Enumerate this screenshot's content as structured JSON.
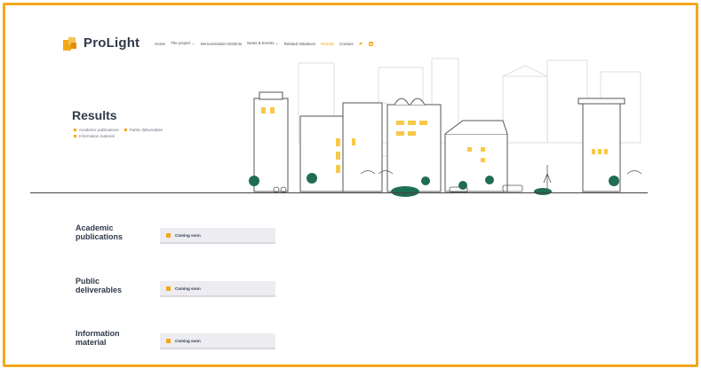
{
  "brand": {
    "name": "ProLight",
    "accent": "#f3a81b"
  },
  "nav": {
    "items": [
      "Home",
      "The project ⌄",
      "Demonstration Districts",
      "News & Events ⌄",
      "Related Initiatives",
      "Results",
      "Contact"
    ],
    "active_index": 5
  },
  "hero": {
    "title": "Results",
    "links": [
      "Academic publications",
      "Public deliverables",
      "Information material"
    ]
  },
  "sections": [
    {
      "title": "Academic publications",
      "status": "Coming soon"
    },
    {
      "title": "Public deliverables",
      "status": "Coming soon"
    },
    {
      "title": "Information material",
      "status": "Coming soon"
    }
  ]
}
